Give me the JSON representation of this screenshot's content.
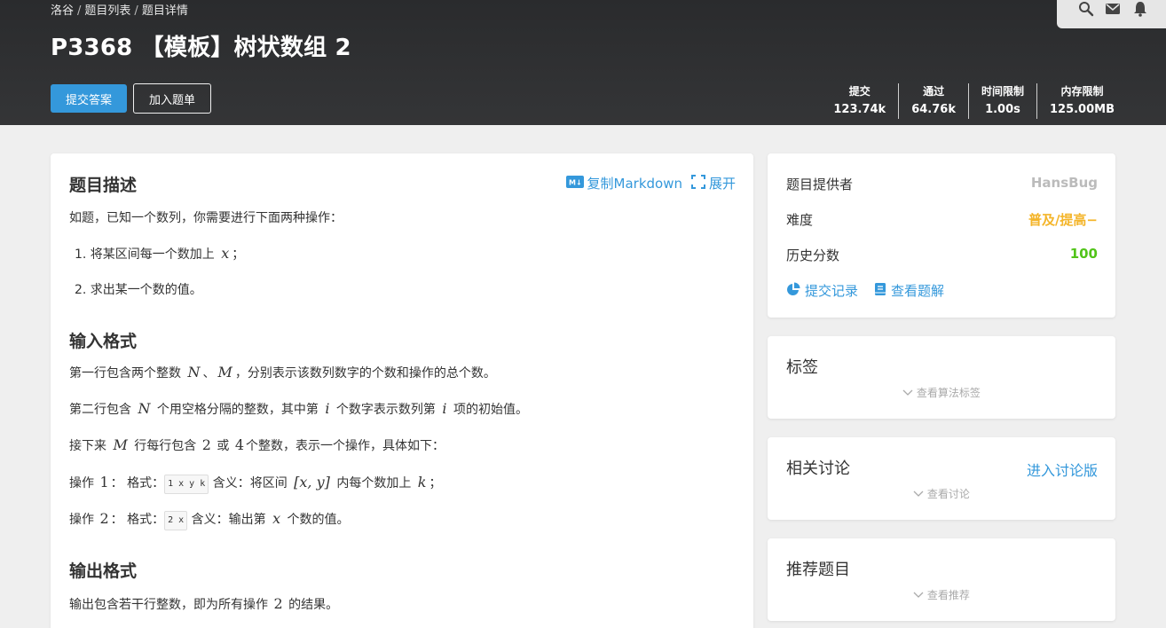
{
  "breadcrumb": [
    "洛谷",
    "题目列表",
    "题目详情"
  ],
  "breadcrumb_sep": "/",
  "title": "P3368 【模板】树状数组 2",
  "buttons": {
    "submit": "提交答案",
    "add_list": "加入题单"
  },
  "stats": [
    {
      "label": "提交",
      "value": "123.74k"
    },
    {
      "label": "通过",
      "value": "64.76k"
    },
    {
      "label": "时间限制",
      "value": "1.00s"
    },
    {
      "label": "内存限制",
      "value": "125.00MB"
    }
  ],
  "description": {
    "heading": "题目描述",
    "copy_markdown": "复制Markdown",
    "expand": "展开",
    "intro": "如题，已知一个数列，你需要进行下面两种操作：",
    "op1_pre": "1. 将某区间每一个数加上 ",
    "op1_var": "x",
    "op1_post": "；",
    "op2": "2. 求出某一个数的值。"
  },
  "input": {
    "heading": "输入格式",
    "l1_a": "第一行包含两个整数 ",
    "l1_N": "N",
    "l1_sep": "、",
    "l1_M": "M",
    "l1_b": "，分别表示该数列数字的个数和操作的总个数。",
    "l2_a": "第二行包含 ",
    "l2_N": "N",
    "l2_b": " 个用空格分隔的整数，其中第 ",
    "l2_i": "i",
    "l2_c": " 个数字表示数列第 ",
    "l2_i2": "i",
    "l2_d": " 项的初始值。",
    "l3_a": "接下来 ",
    "l3_M": "M",
    "l3_b": " 行每行包含 ",
    "l3_2": "2",
    "l3_c": " 或 ",
    "l3_4": "4",
    "l3_d": "个整数，表示一个操作，具体如下：",
    "l4_a": "操作 ",
    "l4_1": "1",
    "l4_b": "： 格式：",
    "l4_code": "1 x y k",
    "l4_c": " 含义：将区间 ",
    "l4_range": "[x, y]",
    "l4_d": " 内每个数加上 ",
    "l4_k": "k",
    "l4_e": "；",
    "l5_a": "操作 ",
    "l5_2": "2",
    "l5_b": "： 格式：",
    "l5_code": "2 x",
    "l5_c": " 含义：输出第 ",
    "l5_x": "x",
    "l5_d": " 个数的值。"
  },
  "output": {
    "heading": "输出格式",
    "l1_a": "输出包含若干行整数，即为所有操作 ",
    "l1_2": "2",
    "l1_b": " 的结果。"
  },
  "info": {
    "provider_label": "题目提供者",
    "provider": "HansBug",
    "difficulty_label": "难度",
    "difficulty": "普及/提高−",
    "score_label": "历史分数",
    "score": "100",
    "records": "提交记录",
    "solutions": "查看题解"
  },
  "tags": {
    "title": "标签",
    "more": "查看算法标签"
  },
  "discuss": {
    "title": "相关讨论",
    "enter": "进入讨论版",
    "more": "查看讨论"
  },
  "recommend": {
    "title": "推荐题目",
    "more": "查看推荐"
  },
  "colors": {
    "accent": "#3498db",
    "orange": "#f4b52a",
    "green": "#52c41a",
    "header": "#2f3032"
  },
  "icons": [
    "search-icon",
    "mail-icon",
    "bell-icon",
    "markdown-icon",
    "expand-icon",
    "pie-chart-icon",
    "book-icon",
    "chevron-down-icon"
  ]
}
